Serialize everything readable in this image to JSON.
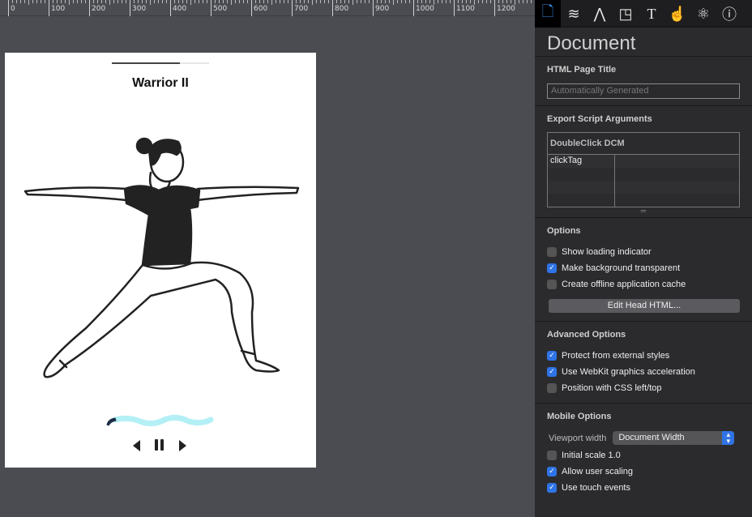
{
  "ruler": {
    "labels": [
      "0",
      "100",
      "200",
      "300",
      "400",
      "500",
      "600",
      "700",
      "800",
      "900",
      "1000",
      "1100",
      "1200"
    ]
  },
  "stage": {
    "title": "Warrior II",
    "progress": 0.7,
    "wave_color": "#b3f0f5",
    "wave_tip_color": "#1e2d44",
    "controls": {
      "prev_icon": "triangle-left-icon",
      "pause_icon": "pause-icon",
      "next_icon": "triangle-right-icon"
    }
  },
  "panel": {
    "tools": [
      "document-icon",
      "layers-icon",
      "compass-icon",
      "shapes-icon",
      "text-icon",
      "hand-pointer-icon",
      "atom-icon",
      "info-icon"
    ],
    "title": "Document",
    "html_title": {
      "label": "HTML Page Title",
      "placeholder": "Automatically Generated"
    },
    "export": {
      "label": "Export Script Arguments",
      "table_header": "DoubleClick DCM",
      "rows": [
        [
          "clickTag",
          ""
        ],
        [
          "",
          ""
        ],
        [
          "",
          ""
        ],
        [
          "",
          ""
        ]
      ]
    },
    "options": {
      "label": "Options",
      "items": [
        {
          "label": "Show loading indicator",
          "checked": false
        },
        {
          "label": "Make background transparent",
          "checked": true
        },
        {
          "label": "Create offline application cache",
          "checked": false
        }
      ],
      "button": "Edit Head HTML..."
    },
    "advanced": {
      "label": "Advanced Options",
      "items": [
        {
          "label": "Protect from external styles",
          "checked": true
        },
        {
          "label": "Use WebKit graphics acceleration",
          "checked": true
        },
        {
          "label": "Position with CSS left/top",
          "checked": false
        }
      ]
    },
    "mobile": {
      "label": "Mobile Options",
      "viewport_label": "Viewport width",
      "viewport_value": "Document Width",
      "items": [
        {
          "label": "Initial scale 1.0",
          "checked": false
        },
        {
          "label": "Allow user scaling",
          "checked": true
        },
        {
          "label": "Use touch events",
          "checked": true
        }
      ]
    }
  },
  "colors": {
    "accent": "#2f74e6",
    "canvas": "#4b4c52",
    "panel": "#2b2b2e"
  }
}
